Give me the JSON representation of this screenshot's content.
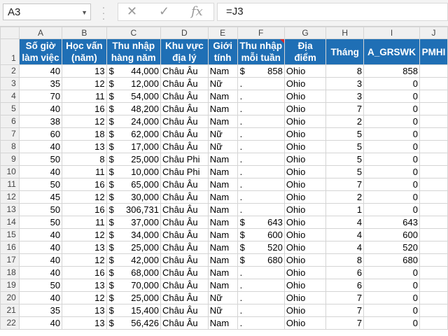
{
  "formula_bar": {
    "name_box": "A3",
    "formula": "=J3",
    "cancel_icon": "✕",
    "enter_icon": "✓",
    "fx_icon": "fx"
  },
  "columns": [
    "A",
    "B",
    "C",
    "D",
    "E",
    "F",
    "G",
    "H",
    "I",
    "J"
  ],
  "headers": [
    "Số giờ làm việc",
    "Học vấn (năm)",
    "Thu nhập hàng năm",
    "Khu vực địa lý",
    "Giới tính",
    "Thu nhập mỗi tuần",
    "Địa điểm",
    "Tháng",
    "A_GRSWK",
    "PMHI"
  ],
  "currency_symbol": "$",
  "rows": [
    {
      "n": "2",
      "hours": "40",
      "edu": "13",
      "income": "44,000",
      "region": "Châu Âu",
      "sex": "Nam",
      "weekly": "858",
      "loc": "Ohio",
      "month": "8",
      "grswk": "858"
    },
    {
      "n": "3",
      "hours": "35",
      "edu": "12",
      "income": "12,000",
      "region": "Châu Âu",
      "sex": "Nữ",
      "weekly": ".",
      "loc": "Ohio",
      "month": "3",
      "grswk": "0"
    },
    {
      "n": "4",
      "hours": "70",
      "edu": "11",
      "income": "54,000",
      "region": "Châu Âu",
      "sex": "Nam",
      "weekly": ".",
      "loc": "Ohio",
      "month": "3",
      "grswk": "0"
    },
    {
      "n": "5",
      "hours": "40",
      "edu": "16",
      "income": "48,200",
      "region": "Châu Âu",
      "sex": "Nam",
      "weekly": ".",
      "loc": "Ohio",
      "month": "7",
      "grswk": "0"
    },
    {
      "n": "6",
      "hours": "38",
      "edu": "12",
      "income": "24,000",
      "region": "Châu Âu",
      "sex": "Nam",
      "weekly": ".",
      "loc": "Ohio",
      "month": "2",
      "grswk": "0"
    },
    {
      "n": "7",
      "hours": "60",
      "edu": "18",
      "income": "62,000",
      "region": "Châu Âu",
      "sex": "Nữ",
      "weekly": ".",
      "loc": "Ohio",
      "month": "5",
      "grswk": "0"
    },
    {
      "n": "8",
      "hours": "40",
      "edu": "13",
      "income": "17,000",
      "region": "Châu Âu",
      "sex": "Nữ",
      "weekly": ".",
      "loc": "Ohio",
      "month": "5",
      "grswk": "0"
    },
    {
      "n": "9",
      "hours": "50",
      "edu": "8",
      "income": "25,000",
      "region": "Châu Phi",
      "sex": "Nam",
      "weekly": ".",
      "loc": "Ohio",
      "month": "5",
      "grswk": "0"
    },
    {
      "n": "10",
      "hours": "40",
      "edu": "11",
      "income": "10,000",
      "region": "Châu Phi",
      "sex": "Nam",
      "weekly": ".",
      "loc": "Ohio",
      "month": "5",
      "grswk": "0"
    },
    {
      "n": "11",
      "hours": "50",
      "edu": "16",
      "income": "65,000",
      "region": "Châu Âu",
      "sex": "Nam",
      "weekly": ".",
      "loc": "Ohio",
      "month": "7",
      "grswk": "0"
    },
    {
      "n": "12",
      "hours": "45",
      "edu": "12",
      "income": "30,000",
      "region": "Châu Âu",
      "sex": "Nam",
      "weekly": ".",
      "loc": "Ohio",
      "month": "2",
      "grswk": "0"
    },
    {
      "n": "13",
      "hours": "50",
      "edu": "16",
      "income": "306,731",
      "region": "Châu Âu",
      "sex": "Nam",
      "weekly": ".",
      "loc": "Ohio",
      "month": "1",
      "grswk": "0"
    },
    {
      "n": "14",
      "hours": "50",
      "edu": "11",
      "income": "37,000",
      "region": "Châu Âu",
      "sex": "Nam",
      "weekly": "643",
      "loc": "Ohio",
      "month": "4",
      "grswk": "643"
    },
    {
      "n": "15",
      "hours": "40",
      "edu": "12",
      "income": "34,000",
      "region": "Châu Âu",
      "sex": "Nam",
      "weekly": "600",
      "loc": "Ohio",
      "month": "4",
      "grswk": "600"
    },
    {
      "n": "16",
      "hours": "40",
      "edu": "13",
      "income": "25,000",
      "region": "Châu Âu",
      "sex": "Nam",
      "weekly": "520",
      "loc": "Ohio",
      "month": "4",
      "grswk": "520"
    },
    {
      "n": "17",
      "hours": "40",
      "edu": "12",
      "income": "42,000",
      "region": "Châu Âu",
      "sex": "Nam",
      "weekly": "680",
      "loc": "Ohio",
      "month": "8",
      "grswk": "680"
    },
    {
      "n": "18",
      "hours": "40",
      "edu": "16",
      "income": "68,000",
      "region": "Châu Âu",
      "sex": "Nam",
      "weekly": ".",
      "loc": "Ohio",
      "month": "6",
      "grswk": "0"
    },
    {
      "n": "19",
      "hours": "50",
      "edu": "13",
      "income": "70,000",
      "region": "Châu Âu",
      "sex": "Nam",
      "weekly": ".",
      "loc": "Ohio",
      "month": "6",
      "grswk": "0"
    },
    {
      "n": "20",
      "hours": "40",
      "edu": "12",
      "income": "25,000",
      "region": "Châu Âu",
      "sex": "Nữ",
      "weekly": ".",
      "loc": "Ohio",
      "month": "7",
      "grswk": "0"
    },
    {
      "n": "21",
      "hours": "35",
      "edu": "13",
      "income": "15,400",
      "region": "Châu Âu",
      "sex": "Nữ",
      "weekly": ".",
      "loc": "Ohio",
      "month": "7",
      "grswk": "0"
    },
    {
      "n": "22",
      "hours": "40",
      "edu": "13",
      "income": "56,426",
      "region": "Châu Âu",
      "sex": "Nam",
      "weekly": ".",
      "loc": "Ohio",
      "month": "7",
      "grswk": "0"
    }
  ],
  "header_row_number": "1",
  "colors": {
    "header_fill": "#1f6fb5",
    "header_text": "#ffffff",
    "comment_marker": "#d9262c"
  }
}
